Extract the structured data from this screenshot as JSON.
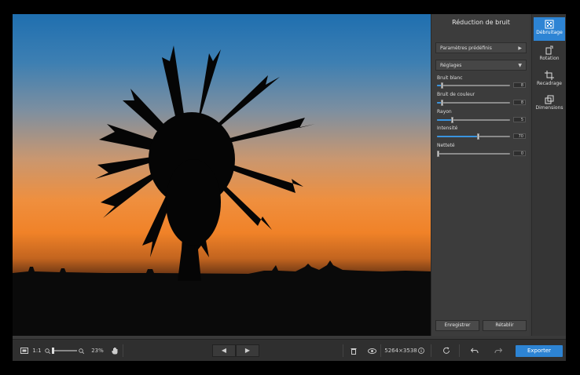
{
  "panel": {
    "title": "Réduction de bruit",
    "presets_label": "Paramètres prédéfinis",
    "settings_label": "Réglages",
    "controls": [
      {
        "label": "Bruit blanc",
        "value": "8",
        "fraction": 0.06
      },
      {
        "label": "Bruit de couleur",
        "value": "8",
        "fraction": 0.06
      },
      {
        "label": "Rayon",
        "value": "5",
        "fraction": 0.2
      },
      {
        "label": "Intensité",
        "value": "70",
        "fraction": 0.57
      },
      {
        "label": "Netteté",
        "value": "0",
        "fraction": 0.0
      }
    ],
    "save_label": "Enregistrer",
    "reset_label": "Rétablir"
  },
  "tools": [
    {
      "label": "Débruitage",
      "icon": "denoise-icon",
      "active": true
    },
    {
      "label": "Rotation",
      "icon": "rotate-icon",
      "active": false
    },
    {
      "label": "Recadrage",
      "icon": "crop-icon",
      "active": false
    },
    {
      "label": "Dimensions",
      "icon": "resize-icon",
      "active": false
    }
  ],
  "bottom": {
    "ratio_label": "1:1",
    "zoom_value": "23%",
    "dimensions": "5264×3538",
    "export_label": "Exporter"
  },
  "colors": {
    "accent": "#2d84d4",
    "panel_bg": "#3c3c3c",
    "bar_bg": "#2f2f2f"
  }
}
